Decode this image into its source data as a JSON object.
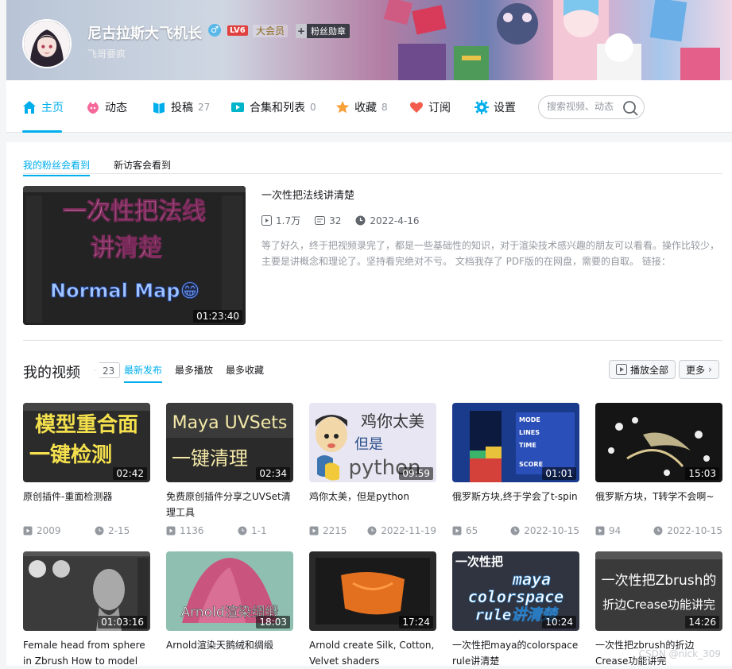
{
  "header": {
    "username": "尼古拉斯大飞机长",
    "gender_symbol": "♂",
    "level": "LV6",
    "vip": "大会员",
    "medal_icon": "+",
    "medal_label": "粉丝勋章",
    "signature": "飞哥要疯"
  },
  "nav": {
    "home": "主页",
    "dynamic": "动态",
    "uploads": "投稿",
    "uploads_count": "27",
    "collections": "合集和列表",
    "collections_count": "0",
    "favorites": "收藏",
    "favorites_count": "8",
    "subscriptions": "订阅",
    "settings": "设置",
    "search_placeholder": "搜索视频、动态"
  },
  "featured": {
    "tabs": [
      "我的粉丝会看到",
      "新访客会看到"
    ],
    "title": "一次性把法线讲清楚",
    "thumb_line1": "一次性把法线",
    "thumb_line2": "讲清楚",
    "thumb_line3": "Normal Map😁",
    "duration": "01:23:40",
    "views": "1.7万",
    "danmaku": "32",
    "date": "2022-4-16",
    "description": "等了好久，终于把视频录完了，都是一些基础性的知识，对于渲染技术感兴趣的朋友可以看看。操作比较少，主要是讲概念和理论了。坚持看完绝对不亏。 文档我存了 PDF版的在网盘，需要的自取。 链接："
  },
  "videos_section": {
    "title": "我的视频",
    "count": "23",
    "sort_tabs": [
      "最新发布",
      "最多播放",
      "最多收藏"
    ],
    "play_all": "播放全部",
    "more": "更多"
  },
  "videos": [
    {
      "title": "原创插件-重面检测器",
      "thumb_text1": "模型重合面",
      "thumb_text2": "一键检测",
      "duration": "02:42",
      "views": "2009",
      "date": "2-15"
    },
    {
      "title": "免费原创插件分享之UVSet清理工具",
      "thumb_text1": "Maya UVSets",
      "thumb_text2": "一键清理",
      "duration": "02:34",
      "views": "1136",
      "date": "1-1"
    },
    {
      "title": "鸡你太美，但是python",
      "thumb_text1": "鸡你太美",
      "thumb_text2": "但是",
      "thumb_text3": "python",
      "duration": "09:59",
      "views": "2215",
      "date": "2022-11-19"
    },
    {
      "title": "俄罗斯方块,终于学会了t-spin",
      "thumb_text1": "MODE",
      "thumb_text2": "LINES",
      "thumb_text3": "TIME",
      "thumb_text4": "SCORE",
      "duration": "01:01",
      "views": "65",
      "date": "2022-10-15"
    },
    {
      "title": "俄罗斯方块，T转学不会啊~",
      "duration": "15:03",
      "views": "94",
      "date": "2022-10-15"
    },
    {
      "title": "Female head from sphere in Zbrush How to model",
      "duration": "01:03:16"
    },
    {
      "title": "Arnold渲染天鹅绒和绸缎",
      "thumb_text1": "Arnold渲染绸缎",
      "duration": "18:03"
    },
    {
      "title": "Arnold create Silk, Cotton, Velvet shaders",
      "duration": "17:24"
    },
    {
      "title": "一次性把maya的colorspace rule讲清楚",
      "thumb_text1": "一次性把",
      "thumb_text2": "maya",
      "thumb_text3": "colorspace",
      "thumb_text4": "rule讲清楚",
      "duration": "10:24"
    },
    {
      "title": "一次性把zbrush的折边Crease功能讲完",
      "thumb_text1": "一次性把Zbrush的",
      "thumb_text2": "折边Crease功能讲完",
      "duration": "14:26"
    }
  ],
  "watermark": "CSDN @nick_309",
  "colors": {
    "accent": "#00aeec",
    "text": "#18191c",
    "muted": "#9499a0"
  }
}
